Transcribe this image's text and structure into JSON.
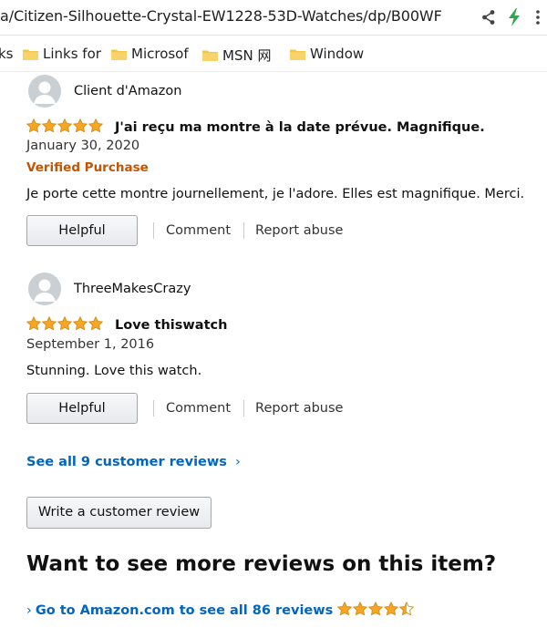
{
  "browser": {
    "url": "a/Citizen-Silhouette-Crystal-EW1228-53D-Watches/dp/B00WF",
    "bookmarks": [
      {
        "label": "ks",
        "icon": "none"
      },
      {
        "label": "Links for",
        "icon": "folder-icon"
      },
      {
        "label": "Microsof",
        "icon": "folder-icon"
      },
      {
        "label": "MSN 网",
        "icon": "folder-icon"
      },
      {
        "label": "Window",
        "icon": "folder-icon"
      }
    ]
  },
  "reviews": [
    {
      "author": "Client d'Amazon",
      "rating": 5,
      "title": "J'ai reçu ma montre à la date prévue. Magnifique.",
      "date": "January 30, 2020",
      "verified": "Verified Purchase",
      "body": "Je porte cette montre journellement, je l'adore. Elles est magnifique. Merci.",
      "helpful_label": "Helpful",
      "comment_label": "Comment",
      "report_label": "Report abuse"
    },
    {
      "author": "ThreeMakesCrazy",
      "rating": 5,
      "title": "Love thiswatch",
      "date": "September 1, 2016",
      "body": "Stunning. Love this watch.",
      "helpful_label": "Helpful",
      "comment_label": "Comment",
      "report_label": "Report abuse"
    }
  ],
  "see_all": {
    "label": "See all 9 customer reviews",
    "chevron": "›"
  },
  "write_review": {
    "label": "Write a customer review"
  },
  "more_reviews": {
    "heading": "Want to see more reviews on this item?",
    "chevron": "›",
    "link_label": "Go to Amazon.com to see all 86 reviews",
    "rating": 4.5
  },
  "colors": {
    "star": "#f6a623",
    "link": "#0066c0",
    "verified": "#c45500"
  }
}
